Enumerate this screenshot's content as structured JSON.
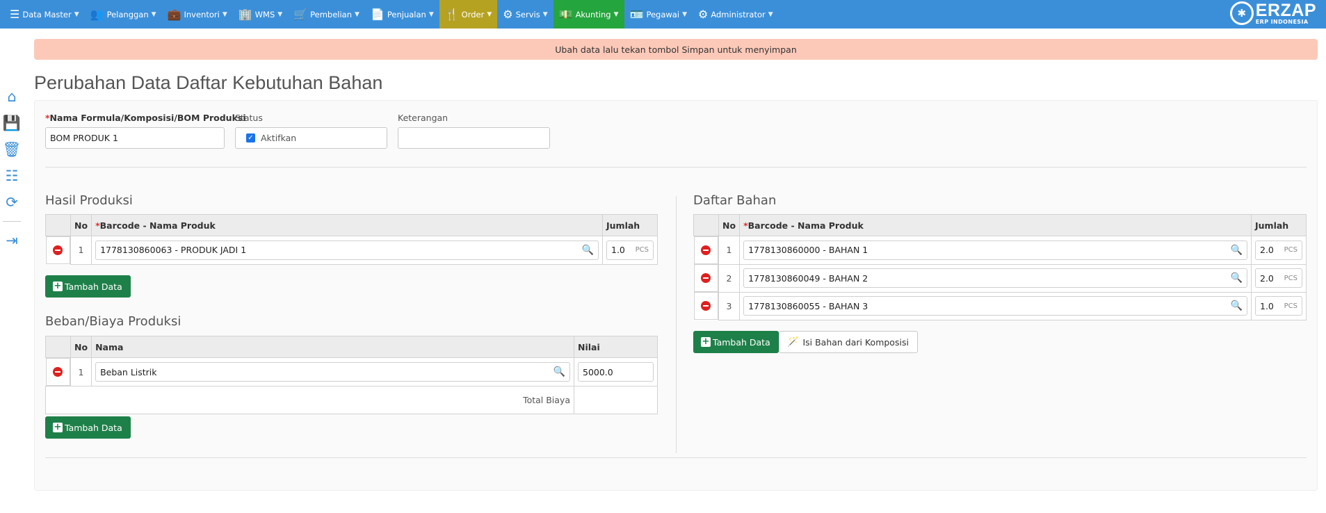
{
  "nav": {
    "items": [
      {
        "label": "Data Master",
        "icon": "list-icon",
        "glyph": "☰"
      },
      {
        "label": "Pelanggan",
        "icon": "users-icon",
        "glyph": "👥"
      },
      {
        "label": "Inventori",
        "icon": "briefcase-icon",
        "glyph": "💼"
      },
      {
        "label": "WMS",
        "icon": "building-icon",
        "glyph": "🏢"
      },
      {
        "label": "Pembelian",
        "icon": "cart-icon",
        "glyph": "🛒"
      },
      {
        "label": "Penjualan",
        "icon": "copy-icon",
        "glyph": "📄"
      },
      {
        "label": "Order",
        "icon": "cutlery-icon",
        "glyph": "🍴"
      },
      {
        "label": "Servis",
        "icon": "gears-icon",
        "glyph": "⚙"
      },
      {
        "label": "Akunting",
        "icon": "money-icon",
        "glyph": "💵"
      },
      {
        "label": "Pegawai",
        "icon": "id-card-icon",
        "glyph": "🪪"
      },
      {
        "label": "Administrator",
        "icon": "gear-icon",
        "glyph": "⚙"
      }
    ],
    "brand": {
      "name": "ERZAP",
      "tagline": "ERP INDONESIA"
    }
  },
  "sidebar": {
    "home": "⌂",
    "save": "💾",
    "delete": "🗑",
    "list": "☷",
    "refresh": "⟳",
    "logout": "⇥"
  },
  "alert": "Ubah data lalu tekan tombol Simpan untuk menyimpan",
  "title": "Perubahan Data Daftar Kebutuhan Bahan",
  "form": {
    "name_label": "Nama Formula/Komposisi/BOM Produksi",
    "name_value": "BOM PRODUK 1",
    "status_label": "Status",
    "status_option": "Aktifkan",
    "note_label": "Keterangan",
    "note_value": ""
  },
  "hasil": {
    "title": "Hasil Produksi",
    "headers": {
      "no": "No",
      "product": "Barcode - Nama Produk",
      "qty": "Jumlah"
    },
    "rows": [
      {
        "no": "1",
        "product": "1778130860063 - PRODUK JADI 1",
        "qty": "1.0",
        "unit": "PCS"
      }
    ],
    "add_label": "Tambah Data"
  },
  "beban": {
    "title": "Beban/Biaya Produksi",
    "headers": {
      "no": "No",
      "name": "Nama",
      "value": "Nilai"
    },
    "rows": [
      {
        "no": "1",
        "name": "Beban Listrik",
        "value": "5000.0"
      }
    ],
    "total_label": "Total Biaya",
    "add_label": "Tambah Data"
  },
  "bahan": {
    "title": "Daftar Bahan",
    "headers": {
      "no": "No",
      "product": "Barcode - Nama Produk",
      "qty": "Jumlah"
    },
    "rows": [
      {
        "no": "1",
        "product": "1778130860000 - BAHAN 1",
        "qty": "2.0",
        "unit": "PCS"
      },
      {
        "no": "2",
        "product": "1778130860049 - BAHAN 2",
        "qty": "2.0",
        "unit": "PCS"
      },
      {
        "no": "3",
        "product": "1778130860055 - BAHAN 3",
        "qty": "1.0",
        "unit": "PCS"
      }
    ],
    "add_label": "Tambah Data",
    "fill_label": "Isi Bahan dari Komposisi"
  },
  "colors": {
    "nav": "#3b8fd9",
    "order": "#b6a221",
    "akunting": "#25a53d",
    "alert": "#fcc9b8",
    "button": "#1e8049",
    "remove": "#e01f1f"
  }
}
